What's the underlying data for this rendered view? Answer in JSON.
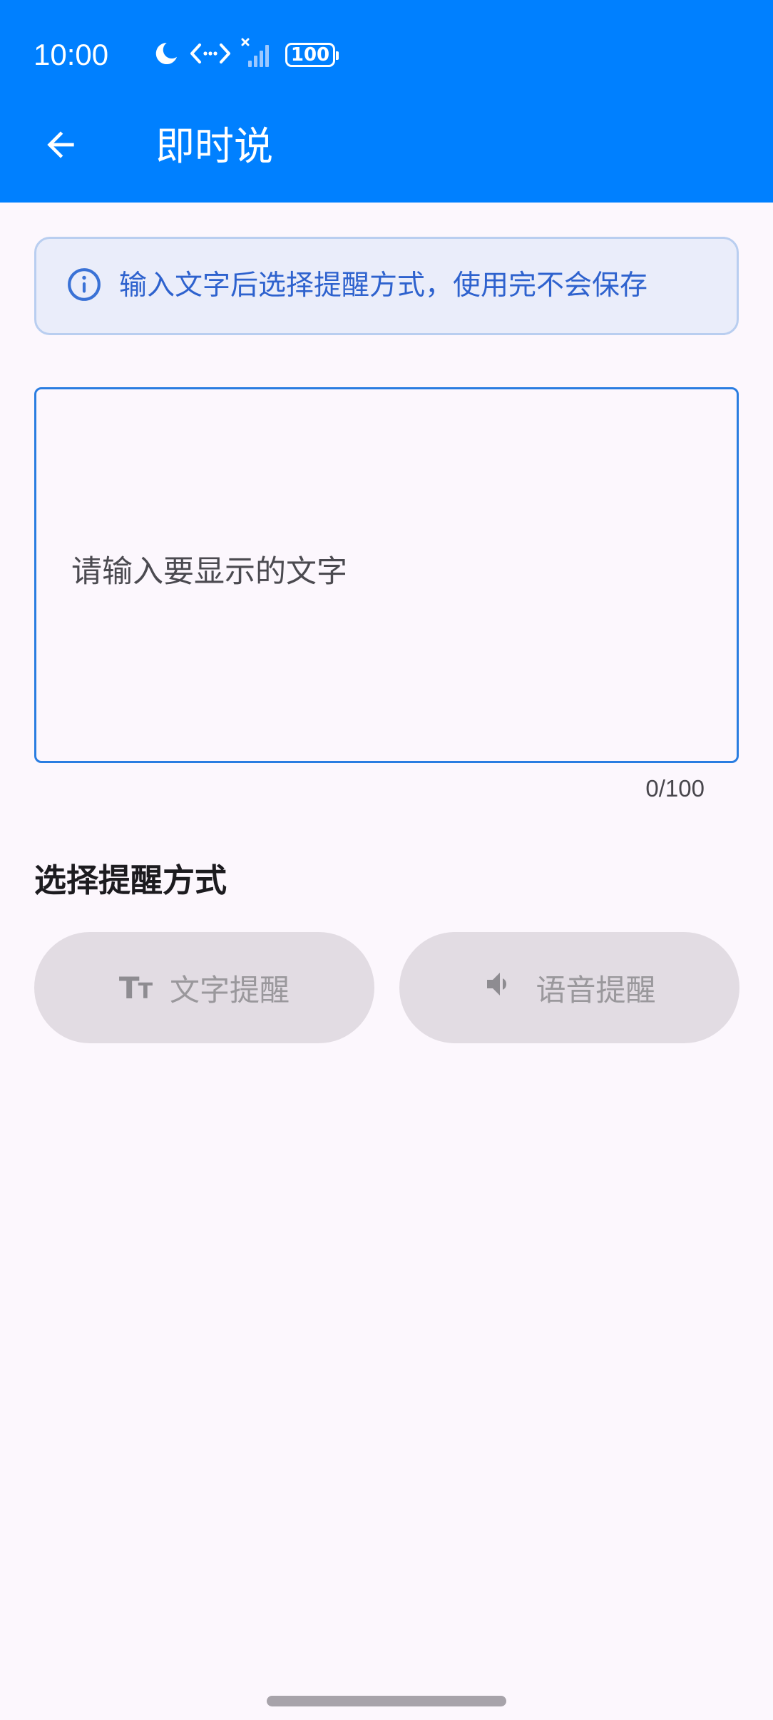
{
  "status_bar": {
    "time": "10:00",
    "battery": "100"
  },
  "header": {
    "title": "即时说"
  },
  "info": {
    "text": "输入文字后选择提醒方式，使用完不会保存"
  },
  "input": {
    "value": "",
    "placeholder": "请输入要显示的文字",
    "counter": "0/100"
  },
  "remind": {
    "section_title": "选择提醒方式",
    "text_button_label": "文字提醒",
    "voice_button_label": "语音提醒"
  },
  "colors": {
    "app_bar": "#0080FF",
    "background": "#FCF7FD",
    "info_text": "#2E62CE",
    "input_border": "#2A7DE1",
    "button_disabled": "#E2DCE3"
  },
  "icons": {
    "moon": "moon-icon",
    "data_transfer": "data-transfer-icon",
    "signal": "signal-icon",
    "back": "arrow-back-icon",
    "info": "info-icon",
    "text_size": "text-fields-icon",
    "volume": "volume-icon"
  }
}
